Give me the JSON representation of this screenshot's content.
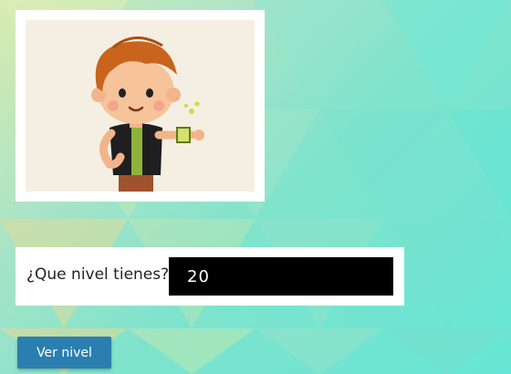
{
  "level_form": {
    "label": "¿Que nivel tienes?",
    "input_value": "20"
  },
  "button": {
    "label": "Ver nivel"
  },
  "image": {
    "subject": "cartoon boy with watch illustration"
  }
}
